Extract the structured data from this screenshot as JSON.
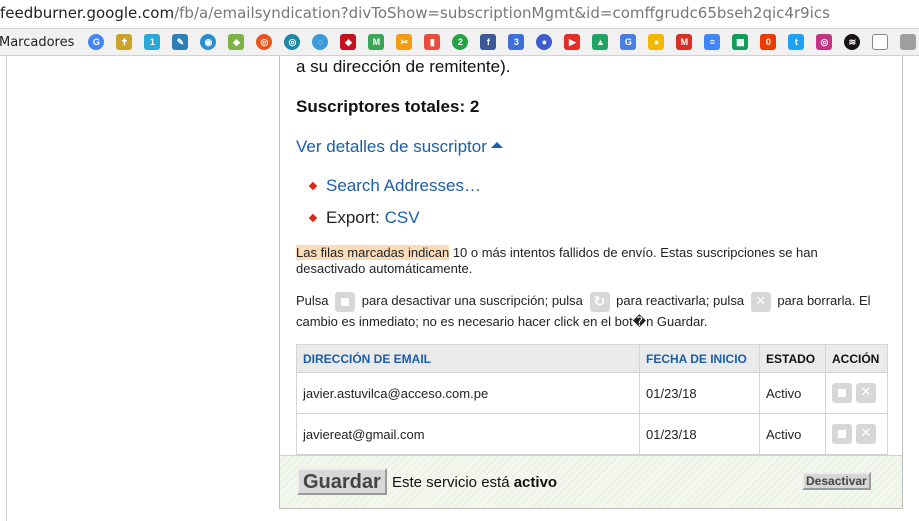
{
  "browser": {
    "url_host": "feedburner.google.com",
    "url_path": "/fb/a/emailsyndication?divToShow=subscriptionMgmt&id=comffgrudc65bseh2qic4r9ics",
    "bookmarks_label": "Marcadores",
    "bookmark_icons": [
      {
        "name": "google-icon",
        "glyph": "G",
        "color": "#4285f4",
        "round": true
      },
      {
        "name": "cross-icon",
        "glyph": "✝",
        "color": "#c9a227"
      },
      {
        "name": "blue-app-icon",
        "glyph": "1",
        "color": "#2aa8d8"
      },
      {
        "name": "tool-icon",
        "glyph": "✎",
        "color": "#2d7fb8"
      },
      {
        "name": "blue-globe-icon",
        "glyph": "◉",
        "color": "#2a8fd0",
        "round": true
      },
      {
        "name": "android-icon",
        "glyph": "◆",
        "color": "#7cb342"
      },
      {
        "name": "ubuntu-icon",
        "glyph": "◎",
        "color": "#e95420",
        "round": true
      },
      {
        "name": "teal-icon",
        "glyph": "◎",
        "color": "#1e88a8",
        "round": true
      },
      {
        "name": "swirl-icon",
        "glyph": "◌",
        "color": "#3b9ad9",
        "round": true
      },
      {
        "name": "ruby-icon",
        "glyph": "◆",
        "color": "#c3121d"
      },
      {
        "name": "green-m-icon",
        "glyph": "M",
        "color": "#3aa655"
      },
      {
        "name": "scissors-icon",
        "glyph": "✂",
        "color": "#f39c12"
      },
      {
        "name": "bookmark-red-icon",
        "glyph": "▮",
        "color": "#e74c3c"
      },
      {
        "name": "whatsapp-icon",
        "glyph": "2",
        "color": "#25a244",
        "round": true
      },
      {
        "name": "facebook-icon",
        "glyph": "f",
        "color": "#3b5998"
      },
      {
        "name": "calendar-icon",
        "glyph": "3",
        "color": "#3e6fd8"
      },
      {
        "name": "profile-icon",
        "glyph": "●",
        "color": "#3d5ccf",
        "round": true
      },
      {
        "name": "youtube-icon",
        "glyph": "▶",
        "color": "#e52d27"
      },
      {
        "name": "drive-icon",
        "glyph": "▲",
        "color": "#1fa463"
      },
      {
        "name": "translate-icon",
        "glyph": "G",
        "color": "#4a7ee0"
      },
      {
        "name": "keep-icon",
        "glyph": "●",
        "color": "#f5b800"
      },
      {
        "name": "gmail-icon",
        "glyph": "M",
        "color": "#d93025"
      },
      {
        "name": "docs-icon",
        "glyph": "≡",
        "color": "#4285f4"
      },
      {
        "name": "sheets-icon",
        "glyph": "▦",
        "color": "#0f9d58"
      },
      {
        "name": "office-icon",
        "glyph": "0",
        "color": "#eb3c00"
      },
      {
        "name": "twitter-icon",
        "glyph": "t",
        "color": "#1da1f2"
      },
      {
        "name": "instagram-icon",
        "glyph": "◎",
        "color": "#c13584"
      },
      {
        "name": "spotify-icon",
        "glyph": "≋",
        "color": "#191414",
        "round": true
      },
      {
        "name": "blank-page-icon",
        "glyph": "",
        "color": "#ffffff"
      },
      {
        "name": "folder-icon",
        "glyph": "",
        "color": "#9e9e9e"
      }
    ]
  },
  "content": {
    "remitente_text": "a su dirección de remitente).",
    "totales_text": "Suscriptores totales: 2",
    "details_link": "Ver detalles de suscriptor",
    "search_link": "Search Addresses…",
    "export_label": "Export:",
    "export_link": "CSV",
    "notice_highlight": "Las filas marcadas indican",
    "notice_rest": " 10 o más intentos fallidos de envío. Estas suscripciones se han",
    "notice_line2": "desactivado automáticamente.",
    "help_pulsa": "Pulsa",
    "help_deactivate": "para desactivar una suscripción; pulsa",
    "help_reactivate": "para reactivarla; pulsa",
    "help_delete": "para borrarla. El",
    "help_line2": "cambio es inmediato; no es necesario hacer click en el bot�n Guardar."
  },
  "table": {
    "headers": {
      "email": "DIRECCIÓN DE EMAIL",
      "start": "FECHA DE INICIO",
      "status": "ESTADO",
      "action": "ACCIÓN"
    },
    "rows": [
      {
        "email": "javier.astuvilca@acceso.com.pe",
        "date": "01/23/18",
        "status": "Activo"
      },
      {
        "email": "javiereat@gmail.com",
        "date": "01/23/18",
        "status": "Activo"
      }
    ]
  },
  "footer": {
    "save_label": "Guardar",
    "service_text": "Este servicio está ",
    "service_state": "activo",
    "deactivate_label": "Desactivar"
  }
}
